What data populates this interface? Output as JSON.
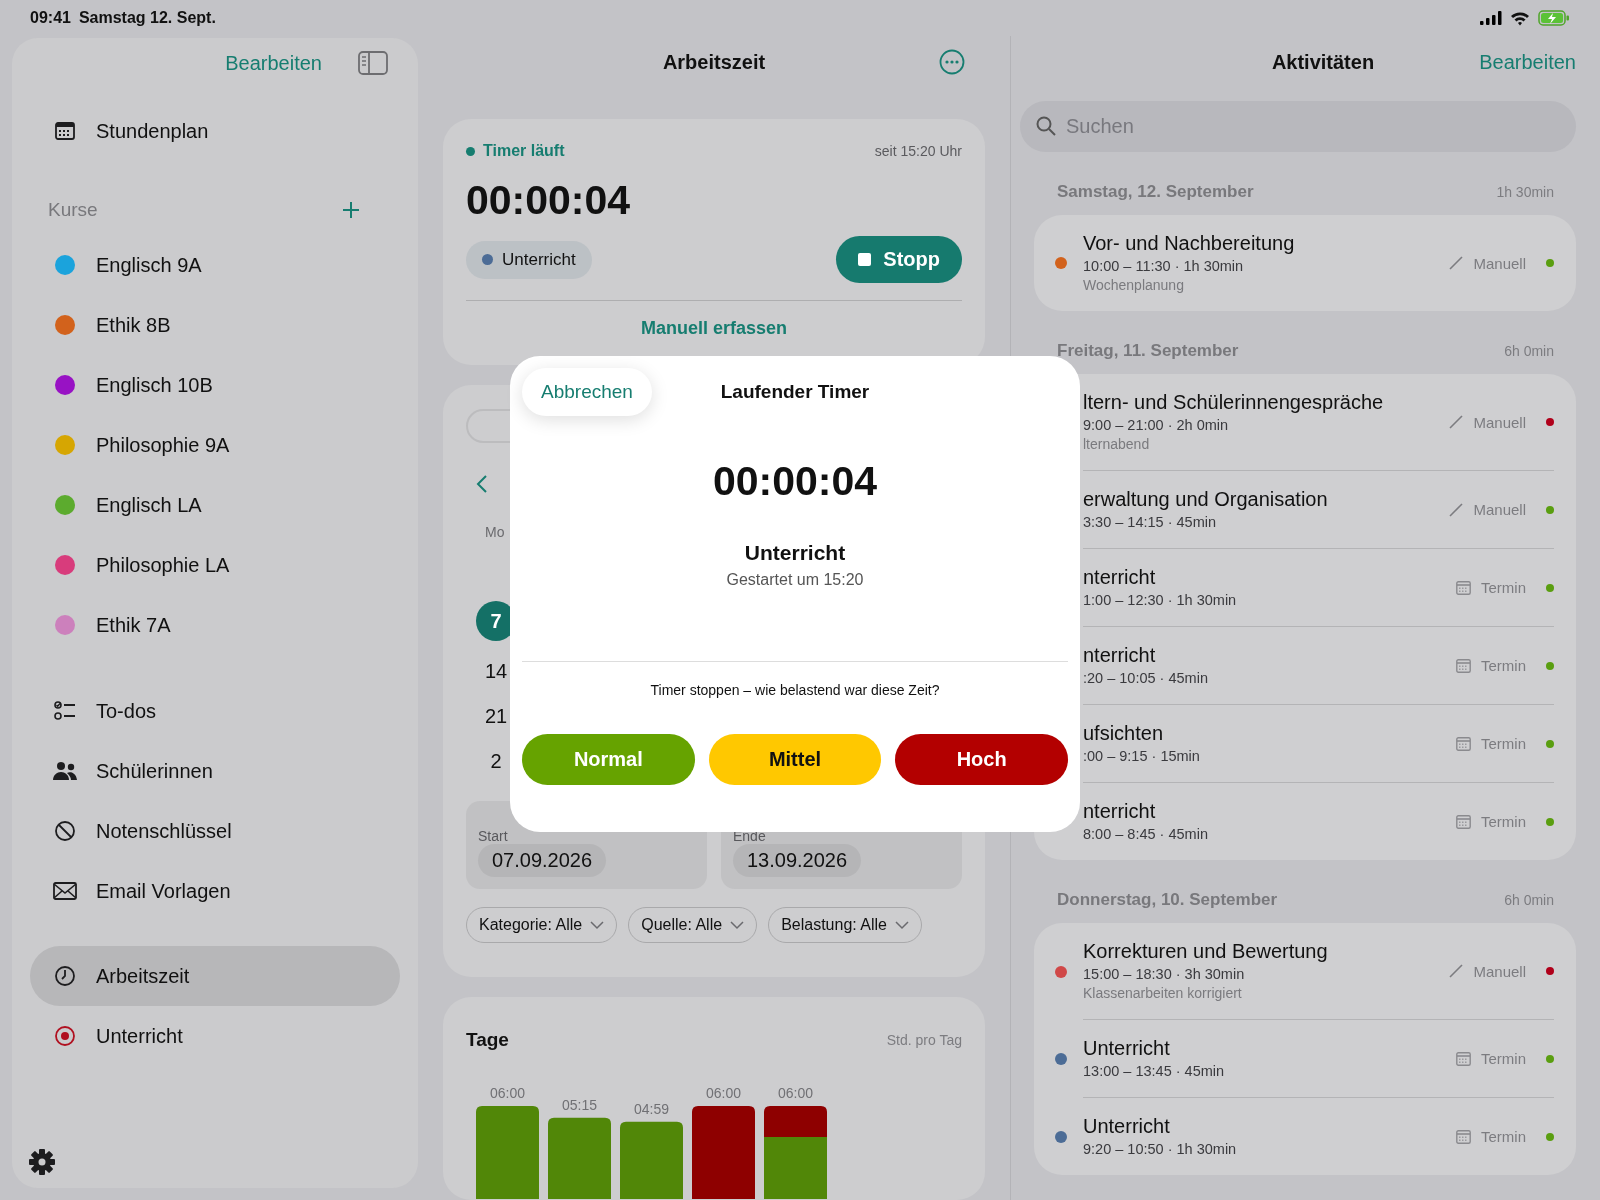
{
  "status_bar": {
    "time": "09:41",
    "date": "Samstag 12. Sept."
  },
  "sidebar": {
    "edit_button": "Bearbeiten",
    "nav_top": [
      {
        "label": "Stundenplan",
        "kind": "calendar",
        "selected": false
      }
    ],
    "courses_heading": "Kurse",
    "courses": [
      {
        "label": "Englisch 9A",
        "color": "#1ba3dc"
      },
      {
        "label": "Ethik 8B",
        "color": "#d2621c"
      },
      {
        "label": "Englisch 10B",
        "color": "#9812c4"
      },
      {
        "label": "Philosophie 9A",
        "color": "#d6a602"
      },
      {
        "label": "Englisch LA",
        "color": "#5cab2e"
      },
      {
        "label": "Philosophie LA",
        "color": "#d83c7c"
      },
      {
        "label": "Ethik 7A",
        "color": "#cc80bc"
      }
    ],
    "nav": [
      {
        "label": "To-dos",
        "kind": "todo",
        "selected": false
      },
      {
        "label": "Schülerinnen",
        "kind": "people",
        "selected": false
      },
      {
        "label": "Notenschlüssel",
        "kind": "grades",
        "selected": false
      },
      {
        "label": "Email Vorlagen",
        "kind": "mail",
        "selected": false
      }
    ],
    "nav_bottom": [
      {
        "label": "Arbeitszeit",
        "kind": "clock",
        "selected": true
      },
      {
        "label": "Unterricht",
        "kind": "target",
        "selected": false
      }
    ]
  },
  "main": {
    "title": "Arbeitszeit",
    "timer_card": {
      "status": "Timer läuft",
      "since": "seit 15:20 Uhr",
      "time": "00:00:04",
      "category": {
        "label": "Unterricht",
        "color": "#4c6c96"
      },
      "stop_button": "Stopp",
      "manual_link": "Manuell erfassen"
    },
    "range_card": {
      "weekday": "Mo",
      "days": [
        {
          "label": "7",
          "selected": true
        },
        {
          "label": "14",
          "selected": false
        },
        {
          "label": "21",
          "selected": false
        },
        {
          "label": "2",
          "selected": false
        }
      ],
      "start": {
        "label": "Start",
        "value": "07.09.2026"
      },
      "end": {
        "label": "Ende",
        "value": "13.09.2026"
      },
      "filters": [
        "Kategorie: Alle",
        "Quelle: Alle",
        "Belastung: Alle"
      ]
    },
    "days_card": {
      "title": "Tage",
      "unit": "Std. pro Tag",
      "chart_data": {
        "type": "bar",
        "stacked": true,
        "series": [
          {
            "color": "#518708",
            "values": [
              6,
              5.25,
              4.98,
              null,
              4
            ],
            "value_labels": [
              "06:00",
              "05:15",
              "04:59",
              null,
              null
            ]
          },
          {
            "color": "#8e0000",
            "values": [
              null,
              null,
              null,
              6,
              2
            ],
            "value_labels": [
              null,
              null,
              null,
              "06:00",
              null
            ]
          }
        ],
        "annotations": [
          {
            "y": 6,
            "text": "06:00"
          }
        ]
      }
    }
  },
  "dialog": {
    "cancel_button": "Abbrechen",
    "title": "Laufender Timer",
    "time": "00:00:04",
    "category": "Unterricht",
    "started": "Gestartet um 15:20",
    "question": "Timer stoppen – wie belastend war diese Zeit?",
    "options": [
      {
        "label": "Normal",
        "color": "#66a300"
      },
      {
        "label": "Mittel",
        "color": "#ffc800"
      },
      {
        "label": "Hoch",
        "color": "#b30000"
      }
    ]
  },
  "activities": {
    "title": "Aktivitäten",
    "edit_button": "Bearbeiten",
    "search": {
      "placeholder": "Suchen"
    },
    "days": [
      {
        "heading": "Samstag, 12. September",
        "total": "1h 30min",
        "entries": [
          {
            "title": "Vor- und Nachbereitung",
            "time": "10:00 – 11:30 · 1h 30min",
            "note": "Wochenplanung",
            "kind": "manual",
            "source": "Manuell",
            "category": {
              "color": "#d2621c"
            },
            "load": {
              "color": "#5a9e10"
            }
          }
        ]
      },
      {
        "heading": "Freitag, 11. September",
        "total": "6h 0min",
        "entries": [
          {
            "title": "ltern- und Schülerinnengespräche",
            "time": "9:00 – 21:00 · 2h 0min",
            "note": "lternabend",
            "kind": "manual",
            "source": "Manuell",
            "load": {
              "color": "#b0001a"
            }
          },
          {
            "title": "erwaltung und Organisation",
            "time": "3:30 – 14:15 · 45min",
            "kind": "manual",
            "source": "Manuell",
            "load": {
              "color": "#5a9e10"
            }
          },
          {
            "title": "nterricht",
            "time": "1:00 – 12:30 · 1h 30min",
            "kind": "appointment",
            "source": "Termin",
            "load": {
              "color": "#5a9e10"
            }
          },
          {
            "title": "nterricht",
            "time": ":20 – 10:05 · 45min",
            "kind": "appointment",
            "source": "Termin",
            "load": {
              "color": "#5a9e10"
            }
          },
          {
            "title": "ufsichten",
            "time": ":00 – 9:15 · 15min",
            "kind": "appointment",
            "source": "Termin",
            "load": {
              "color": "#5a9e10"
            }
          },
          {
            "title": "nterricht",
            "time": "8:00 – 8:45 · 45min",
            "kind": "appointment",
            "source": "Termin",
            "load": {
              "color": "#5a9e10"
            }
          }
        ]
      },
      {
        "heading": "Donnerstag, 10. September",
        "total": "6h 0min",
        "entries": [
          {
            "title": "Korrekturen und Bewertung",
            "time": "15:00 – 18:30 · 3h 30min",
            "note": "Klassenarbeiten korrigiert",
            "kind": "manual",
            "source": "Manuell",
            "category": {
              "color": "#d04848"
            },
            "load": {
              "color": "#b0001a"
            }
          },
          {
            "title": "Unterricht",
            "time": "13:00 – 13:45 · 45min",
            "kind": "appointment",
            "source": "Termin",
            "category": {
              "color": "#4c6c96"
            },
            "load": {
              "color": "#5a9e10"
            }
          },
          {
            "title": "Unterricht",
            "time": "9:20 – 10:50 · 1h 30min",
            "kind": "appointment",
            "source": "Termin",
            "category": {
              "color": "#4c6c96"
            },
            "load": {
              "color": "#5a9e10"
            }
          }
        ]
      }
    ]
  }
}
